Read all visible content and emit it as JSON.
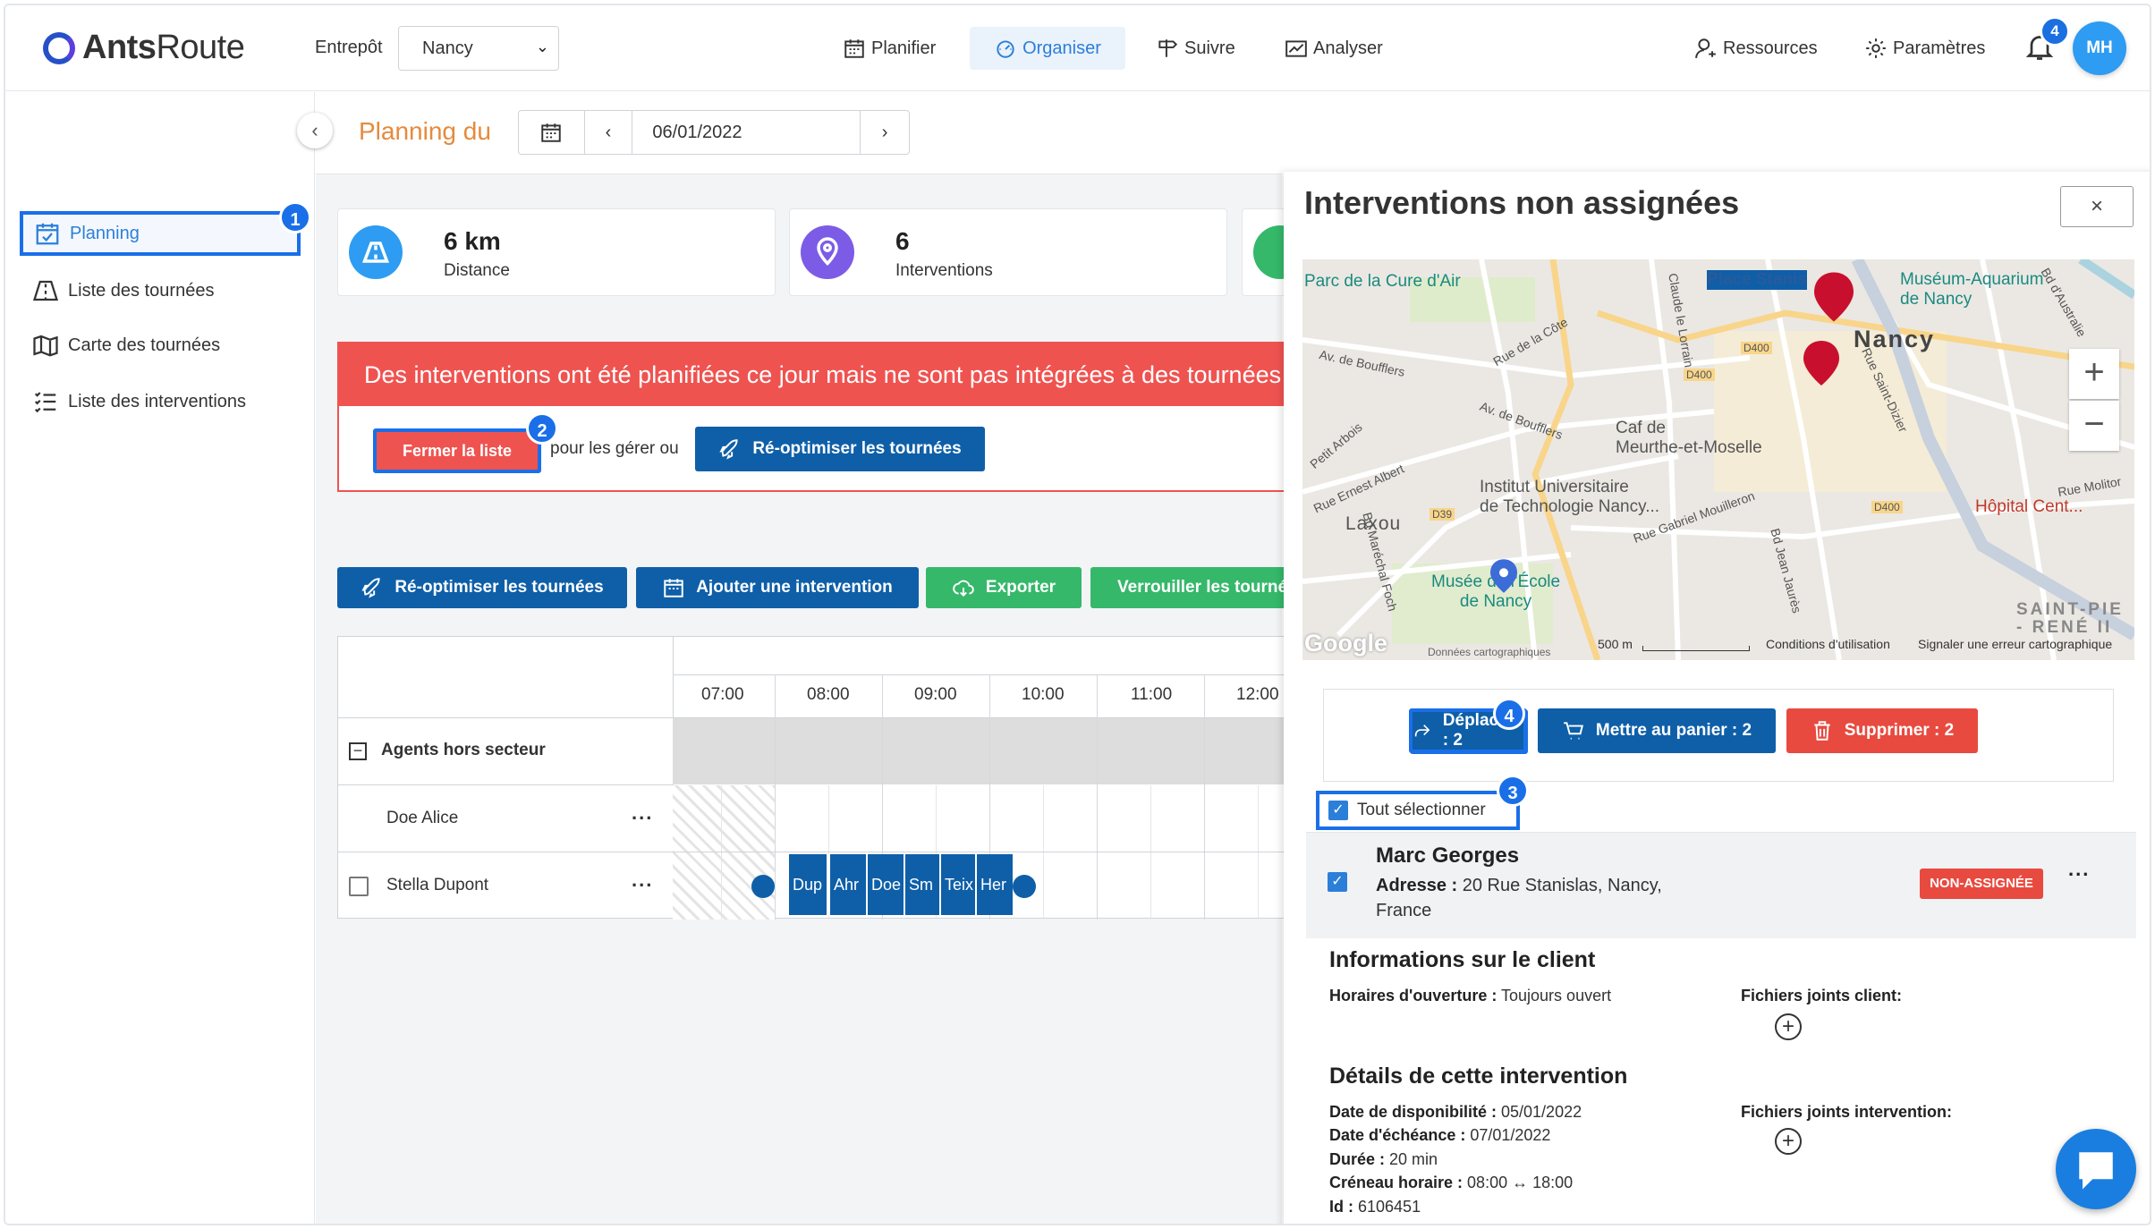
{
  "brand": {
    "name_bold": "Ants",
    "name_light": "Route"
  },
  "header": {
    "entrepot_label": "Entrepôt",
    "entrepot_value": "Nancy",
    "nav": [
      {
        "label": "Planifier",
        "icon": "calendar-icon"
      },
      {
        "label": "Organiser",
        "icon": "dashboard-icon",
        "active": true
      },
      {
        "label": "Suivre",
        "icon": "signpost-icon"
      },
      {
        "label": "Analyser",
        "icon": "chart-icon"
      }
    ],
    "resources": "Ressources",
    "settings": "Paramètres",
    "notif_count": "4",
    "avatar": "MH"
  },
  "sidebar": {
    "items": [
      {
        "label": "Planning",
        "icon": "calendar-check-icon",
        "active": true
      },
      {
        "label": "Liste des tournées",
        "icon": "road-icon"
      },
      {
        "label": "Carte des tournées",
        "icon": "map-icon"
      },
      {
        "label": "Liste des interventions",
        "icon": "list-icon"
      }
    ]
  },
  "steps": [
    "1",
    "2",
    "3",
    "4"
  ],
  "planning": {
    "title": "Planning du",
    "date": "06/01/2022",
    "stats": [
      {
        "value": "6 km",
        "label": "Distance",
        "color": "#2d9cf2"
      },
      {
        "value": "6",
        "label": "Interventions",
        "color": "#7c5ce6"
      }
    ],
    "alert_text": "Des interventions ont été planifiées ce jour mais ne sont pas intégrées à des tournées",
    "close_list": "Fermer la liste",
    "mid_text": "pour les gérer ou",
    "reoptimize": "Ré-optimiser les tournées",
    "toolbar": {
      "reoptimize": "Ré-optimiser les tournées",
      "add": "Ajouter une intervention",
      "export": "Exporter",
      "lock": "Verrouiller les tournées"
    },
    "hours": [
      "07:00",
      "08:00",
      "09:00",
      "10:00",
      "11:00",
      "12:00"
    ],
    "group": "Agents hors secteur",
    "agents": [
      "Doe Alice",
      "Stella Dupont"
    ],
    "more": "...",
    "stops": [
      "Dup",
      "Ahr",
      "Doe",
      "Sm",
      "Teix",
      "Her"
    ]
  },
  "panel": {
    "title": "Interventions non assignées",
    "close": "×",
    "map_labels": {
      "parc": "Parc de la Cure d'Air",
      "place": "Place Stanis",
      "museum": "Muséum-Aquarium\nde Nancy",
      "nancy": "Nancy",
      "cafe": "Caf de\nMeurthe-et-Moselle",
      "iut": "Institut Universitaire\nde Technologie Nancy...",
      "laxou": "Laxou",
      "musee": "Musée de l'École\nde Nancy",
      "hopital": "Hôpital Cent...",
      "saint": "SAINT-PIE\n- RENÉ II",
      "google": "Google",
      "scale": "500 m",
      "terms": "Conditions d'utilisation",
      "report": "Signaler une erreur cartographique",
      "road_boufflers": "Av. de Boufflers",
      "road_boufflers2": "Av. de Boufflers",
      "road_cote": "Rue de la Côte",
      "road_albert": "Rue Ernest Albert",
      "road_mouilleron": "Rue Gabriel Mouilleron",
      "road_jaures": "Bd Jean Jaurès",
      "road_foch": "Bd Maréchal Foch",
      "road_dizier": "Rue Saint-Dizier",
      "road_lorrain": "Claude le Lorrain",
      "road_australie": "Bd d'Australie",
      "road_molitor": "Rue Molitor",
      "road_arbois": "Petit Arbois",
      "d400a": "D400",
      "d400b": "D400",
      "d400c": "D400",
      "d39": "D39",
      "data": "Données cartographiques"
    },
    "move": "Déplacer : 2",
    "cart": "Mettre au panier : 2",
    "delete": "Supprimer : 2",
    "select_all": "Tout sélectionner",
    "card": {
      "name": "Marc Georges",
      "address_label": "Adresse :",
      "address_value": " 20 Rue Stanislas, Nancy,",
      "address_line2": "France",
      "badge": "NON-ASSIGNÉE",
      "menu": "...",
      "client_title": "Informations sur le client",
      "hours_label": "Horaires d'ouverture :",
      "hours_value": " Toujours ouvert",
      "client_files": "Fichiers joints client:",
      "details_title": "Détails de cette intervention",
      "dispo_label": "Date de disponibilité :",
      "dispo_value": " 05/01/2022",
      "due_label": "Date d'échéance :",
      "due_value": " 07/01/2022",
      "duration_label": "Durée :",
      "duration_value": " 20 min",
      "slot_label": "Créneau horaire :",
      "slot_value": " 08:00 ↔ 18:00",
      "id_label": "Id :",
      "id_value": " 6106451",
      "int_files": "Fichiers joints intervention:"
    }
  },
  "colors": {
    "accent": "#1a6fe8",
    "primary": "#0e5fa8",
    "danger": "#ef5350",
    "success": "#35b86a",
    "title": "#e58a3d"
  }
}
